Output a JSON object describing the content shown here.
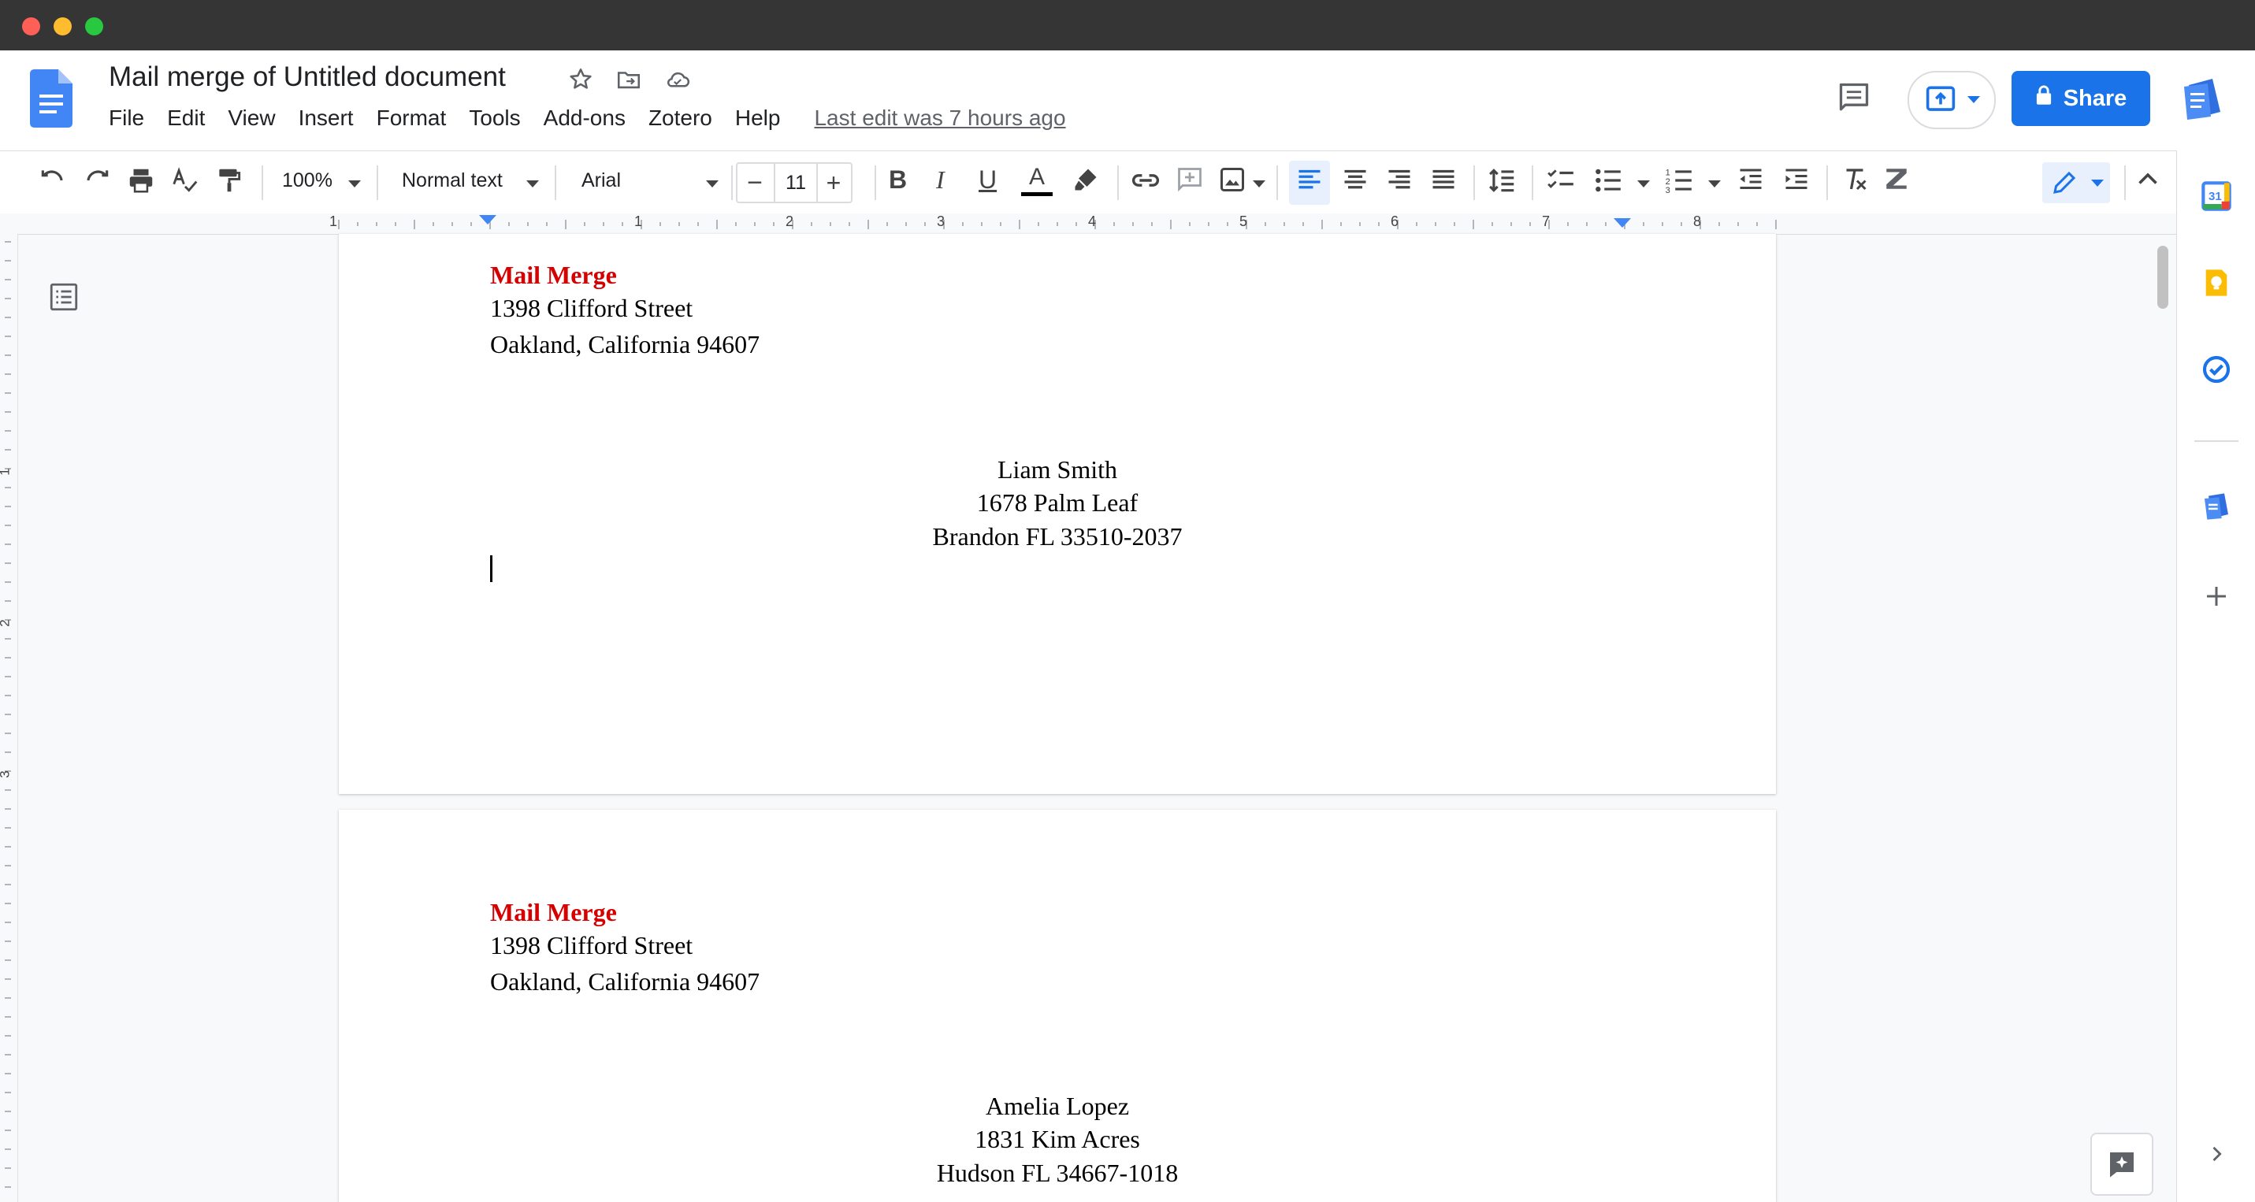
{
  "document": {
    "title": "Mail merge of Untitled document",
    "last_edit": "Last edit was 7 hours ago"
  },
  "menu": [
    "File",
    "Edit",
    "View",
    "Insert",
    "Format",
    "Tools",
    "Add-ons",
    "Zotero",
    "Help"
  ],
  "share_label": "Share",
  "toolbar": {
    "zoom": "100%",
    "style": "Normal text",
    "font": "Arial",
    "font_size": "11"
  },
  "ruler_numbers": [
    "1",
    "1",
    "2",
    "3",
    "4",
    "5",
    "6",
    "7",
    "8"
  ],
  "vruler_numbers": [
    "1",
    "2",
    "3"
  ],
  "pages": [
    {
      "sender_name": "Mail Merge",
      "sender_street": "1398 Clifford Street",
      "sender_city": "Oakland, California 94607",
      "recipient_name": "Liam Smith",
      "recipient_street": "1678 Palm Leaf",
      "recipient_city": "Brandon FL 33510-2037"
    },
    {
      "sender_name": "Mail Merge",
      "sender_street": "1398 Clifford Street",
      "sender_city": "Oakland, California 94607",
      "recipient_name": "Amelia Lopez",
      "recipient_street": "1831 Kim Acres",
      "recipient_city": "Hudson FL 34667-1018"
    }
  ],
  "colors": {
    "accent": "#1a73e8",
    "sender_red": "#d50000",
    "titlebar": "#353535"
  },
  "side_icons": [
    "calendar-icon",
    "keep-icon",
    "tasks-icon",
    "docs-addon-icon",
    "add-icon"
  ]
}
